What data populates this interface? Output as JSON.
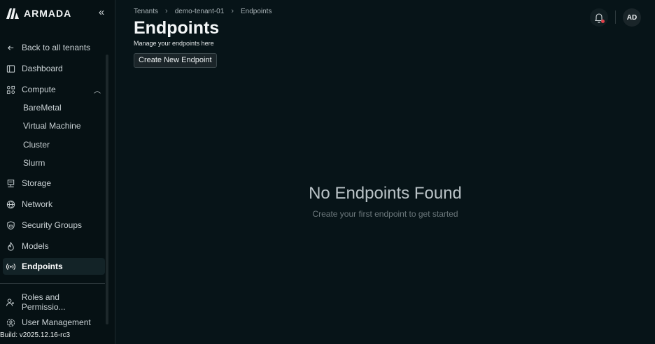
{
  "app": {
    "name": "ARMADA",
    "build": "Build: v2025.12.16-rc3"
  },
  "sidebar": {
    "collapse_icon": "double-chevron-left-icon",
    "items": [
      {
        "label": "Back to all tenants",
        "icon": "arrow-left-icon"
      },
      {
        "label": "Dashboard",
        "icon": "panel-icon"
      },
      {
        "label": "Compute",
        "icon": "nodes-icon",
        "expanded": true
      },
      {
        "label": "BareMetal"
      },
      {
        "label": "Virtual Machine"
      },
      {
        "label": "Cluster"
      },
      {
        "label": "Slurm"
      },
      {
        "label": "Storage",
        "icon": "server-icon"
      },
      {
        "label": "Network",
        "icon": "globe-icon"
      },
      {
        "label": "Security Groups",
        "icon": "shield-icon"
      },
      {
        "label": "Models",
        "icon": "flame-icon"
      },
      {
        "label": "Endpoints",
        "icon": "broadcast-icon",
        "active": true
      },
      {
        "label": "Roles and Permissio...",
        "icon": "users-icon"
      },
      {
        "label": "User Management",
        "icon": "user-gear-icon"
      }
    ]
  },
  "breadcrumb": [
    "Tenants",
    "demo-tenant-01",
    "Endpoints"
  ],
  "page": {
    "title": "Endpoints",
    "subtitle": "Manage your endpoints here",
    "create_label": "Create New Endpoint"
  },
  "header": {
    "avatar_initials": "AD",
    "has_notification": true
  },
  "empty_state": {
    "title": "No Endpoints Found",
    "subtitle": "Create your first endpoint to get started"
  },
  "colors": {
    "background": "#071418",
    "sidebar": "#061114",
    "active_item": "#132327",
    "notification_dot": "#e0414a"
  }
}
